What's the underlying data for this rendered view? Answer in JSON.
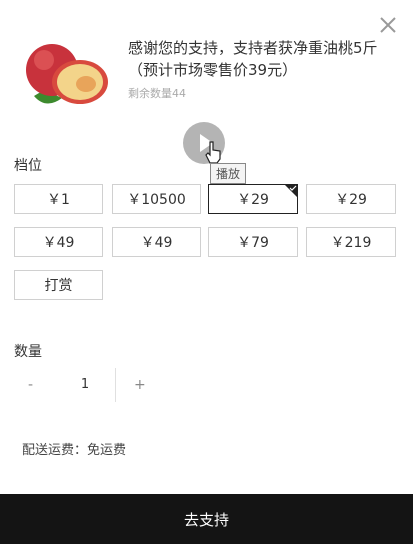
{
  "product": {
    "title": "感谢您的支持，支持者获净重油桃5斤（预计市场零售价39元）",
    "remaining": "剩余数量44"
  },
  "media": {
    "tooltip": "播放"
  },
  "tiers": {
    "label": "档位",
    "options": [
      {
        "label": "￥1"
      },
      {
        "label": "￥10500"
      },
      {
        "label": "￥29"
      },
      {
        "label": "￥29"
      },
      {
        "label": "￥49"
      },
      {
        "label": "￥49"
      },
      {
        "label": "￥79"
      },
      {
        "label": "￥219"
      },
      {
        "label": "打赏"
      }
    ],
    "selected_index": 2
  },
  "quantity": {
    "label": "数量",
    "minus": "-",
    "value": "1",
    "plus": "+"
  },
  "shipping": {
    "text": "配送运费：免运费"
  },
  "submit": {
    "label": "去支持"
  },
  "colors": {
    "submit_bg": "#141414",
    "selected_border": "#222222",
    "fruit_red": "#c8323c"
  }
}
